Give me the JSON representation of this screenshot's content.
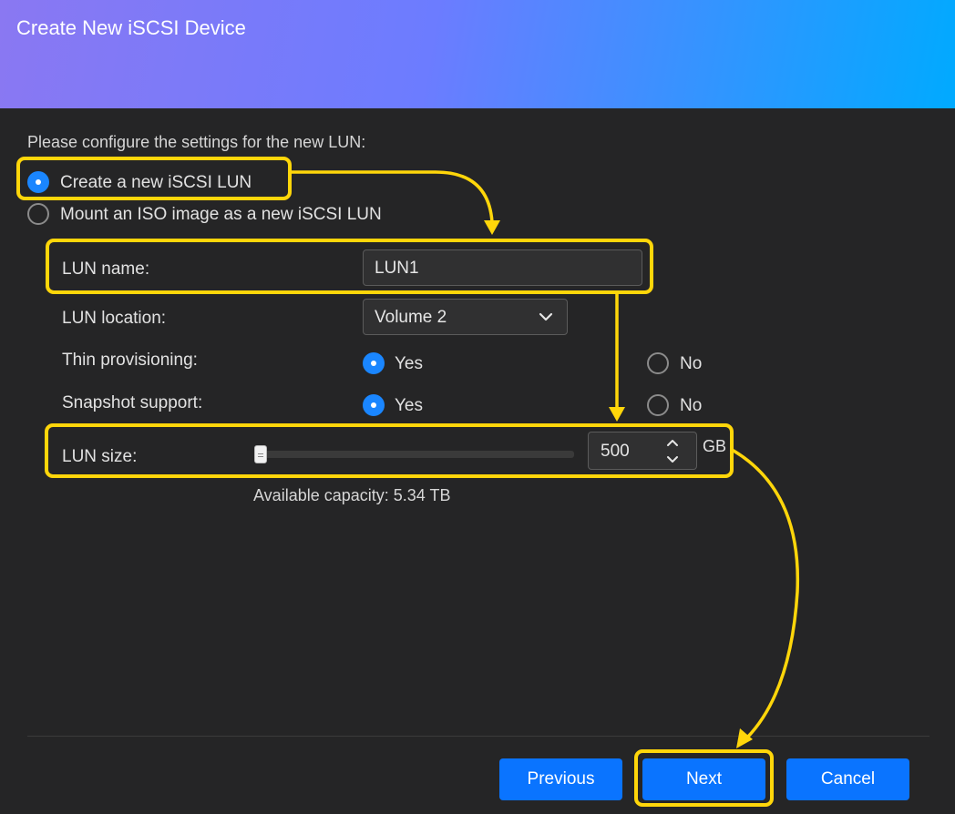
{
  "dialog": {
    "title": "Create New iSCSI Device"
  },
  "intro": "Please configure the settings for the new LUN:",
  "mode": {
    "create_label": "Create a new iSCSI LUN",
    "mount_label": "Mount an ISO image as a new iSCSI LUN",
    "selected": "create"
  },
  "form": {
    "lun_name_label": "LUN name:",
    "lun_name_value": "LUN1",
    "location_label": "LUN location:",
    "location_value": "Volume 2",
    "thin_label": "Thin provisioning:",
    "thin_yes": "Yes",
    "thin_no": "No",
    "thin_selected": "Yes",
    "snapshot_label": "Snapshot support:",
    "snapshot_yes": "Yes",
    "snapshot_no": "No",
    "snapshot_selected": "Yes",
    "size_label": "LUN size:",
    "size_value": "500",
    "size_unit": "GB",
    "slider_level": 0.0,
    "available": "Available capacity: 5.34 TB"
  },
  "footer": {
    "previous": "Previous",
    "next": "Next",
    "cancel": "Cancel"
  },
  "colors": {
    "accent": "#0a74ff",
    "highlight": "#ffd60a",
    "background": "#252526",
    "header_gradient_start": "#8a78f2",
    "header_gradient_end": "#00aaff"
  },
  "icons": {
    "dropdown": "chevron-down-icon",
    "spin_up": "chevron-up-icon",
    "spin_down": "chevron-down-icon"
  }
}
